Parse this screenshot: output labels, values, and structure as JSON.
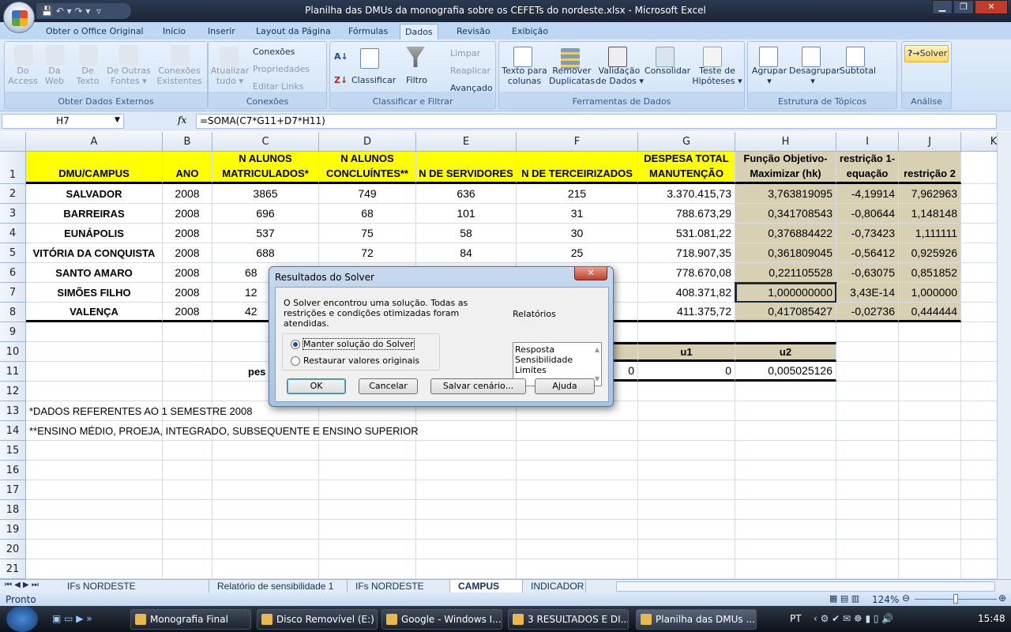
{
  "window": {
    "title": "Planilha das DMUs da monografia sobre os CEFETs do nordeste.xlsx - Microsoft Excel",
    "minimize": "▁",
    "restore": "❐",
    "close": "✕"
  },
  "ribbon": {
    "tabs": [
      "Obter o Office Original",
      "Início",
      "Inserir",
      "Layout da Página",
      "Fórmulas",
      "Dados",
      "Revisão",
      "Exibição"
    ],
    "active_tab": "Dados",
    "groups": {
      "external": {
        "label": "Obter Dados Externos",
        "buttons": [
          "Do\nAccess",
          "Da\nWeb",
          "De\nTexto",
          "De Outras\nFontes ▾",
          "Conexões\nExistentes"
        ]
      },
      "connections": {
        "label": "Conexões",
        "refresh": "Atualizar\ntudo ▾",
        "items": [
          "Conexões",
          "Propriedades",
          "Editar Links"
        ]
      },
      "sort": {
        "label": "Classificar e Filtrar",
        "sort": "Classificar",
        "filter": "Filtro",
        "items": [
          "Limpar",
          "Reaplicar",
          "Avançado"
        ]
      },
      "tools": {
        "label": "Ferramentas de Dados",
        "buttons": [
          "Texto para\ncolunas",
          "Remover\nDuplicatas",
          "Validação\nde Dados ▾",
          "Consolidar",
          "Teste de\nHipóteses ▾"
        ]
      },
      "outline": {
        "label": "Estrutura de Tópicos",
        "buttons": [
          "Agrupar\n▾",
          "Desagrupar\n▾",
          "Subtotal"
        ]
      },
      "analysis": {
        "label": "Análise",
        "solver": "Solver"
      }
    }
  },
  "formula_bar": {
    "name_box": "H7",
    "fx": "fx",
    "formula": "=SOMA(C7*G11+D7*H11)"
  },
  "columns": [
    "A",
    "B",
    "C",
    "D",
    "E",
    "F",
    "G",
    "H",
    "I",
    "J",
    "K"
  ],
  "header_row": [
    "DMU/CAMPUS",
    "ANO",
    "N ALUNOS\nMATRICULADOS*",
    "N ALUNOS\nCONCLUÍNTES**",
    "N DE SERVIDORES",
    "N DE TERCEIRIZADOS",
    "DESPESA TOTAL\nMANUTENÇÃO",
    "Função Objetivo-\nMaximizar (hk)",
    "restrição 1-\nequação",
    "restrição 2"
  ],
  "rows": [
    [
      "SALVADOR",
      "2008",
      "3865",
      "749",
      "636",
      "215",
      "3.370.415,73",
      "3,763819095",
      "-4,19914",
      "7,962963"
    ],
    [
      "BARREIRAS",
      "2008",
      "696",
      "68",
      "101",
      "31",
      "788.673,29",
      "0,341708543",
      "-0,80644",
      "1,148148"
    ],
    [
      "EUNÁPOLIS",
      "2008",
      "537",
      "75",
      "58",
      "30",
      "531.081,22",
      "0,376884422",
      "-0,73423",
      "1,111111"
    ],
    [
      "VITÓRIA DA CONQUISTA",
      "2008",
      "688",
      "72",
      "84",
      "25",
      "718.907,35",
      "0,361809045",
      "-0,56412",
      "0,925926"
    ],
    [
      "SANTO AMARO",
      "2008",
      "68",
      "",
      "",
      "",
      "778.670,08",
      "0,221105528",
      "-0,63075",
      "0,851852"
    ],
    [
      "SIMÕES FILHO",
      "2008",
      "12",
      "",
      "",
      "",
      "408.371,82",
      "1,000000000",
      "3,43E-14",
      "1,000000"
    ],
    [
      "VALENÇA",
      "2008",
      "42",
      "",
      "",
      "",
      "411.375,72",
      "0,417085427",
      "-0,02736",
      "0,444444"
    ]
  ],
  "weights": {
    "label": "pes",
    "u1": "u1",
    "u2": "u2",
    "f11": "0",
    "g11": "0",
    "h11": "0,005025126"
  },
  "notes": [
    "*DADOS REFERENTES AO 1 SEMESTRE 2008",
    "**ENSINO MÉDIO, PROEJA, INTEGRADO, SUBSEQUENTE E ENSINO SUPERIOR"
  ],
  "row_numbers": [
    "1",
    "2",
    "3",
    "4",
    "5",
    "6",
    "7",
    "8",
    "9",
    "10",
    "11",
    "12",
    "13",
    "14",
    "15",
    "16",
    "17",
    "18",
    "19",
    "20",
    "21"
  ],
  "selected_cell": "H7",
  "sheet_tabs": [
    "IFs NORDESTE SELECIONADA",
    "Relatório de sensibilidade 1",
    "IFs NORDESTE DEA",
    "CAMPUS IFBA",
    "INDICADOR"
  ],
  "active_sheet": "CAMPUS IFBA",
  "status": {
    "text": "Pronto",
    "zoom": "124%"
  },
  "dialog": {
    "title": "Resultados do Solver",
    "message": "O Solver encontrou uma solução.  Todas as restrições e condições otimizadas foram atendidas.",
    "options": [
      "Manter solução do Solver",
      "Restaurar valores originais"
    ],
    "selected_option": 0,
    "reports_label": "Relatórios",
    "reports": [
      "Resposta",
      "Sensibilidade",
      "Limites"
    ],
    "buttons": {
      "ok": "OK",
      "cancel": "Cancelar",
      "save": "Salvar cenário...",
      "help": "Ajuda"
    }
  },
  "taskbar": {
    "items": [
      "Monografia Final",
      "Disco Removível (E:)",
      "Google - Windows I...",
      "3 RESULTADOS E DI...",
      "Planilha das DMUs ..."
    ],
    "active": 4,
    "lang": "PT",
    "clock": "15:48"
  },
  "colors": {
    "yellow": "#ffff00",
    "tan": "#d8d0b2",
    "ribbon": "#cbdff5"
  }
}
